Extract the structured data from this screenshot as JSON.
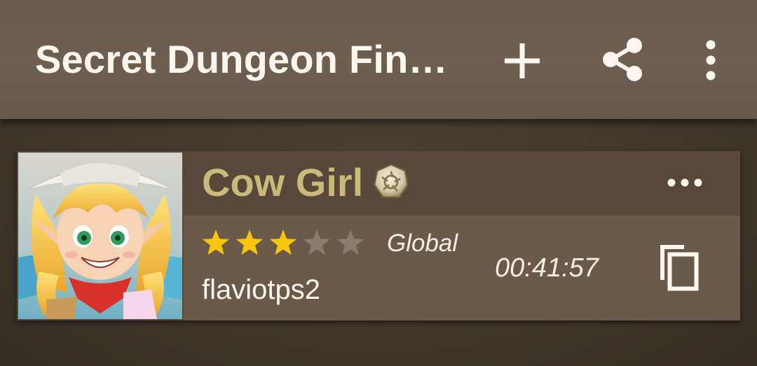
{
  "app_bar": {
    "title": "Secret Dungeon Finder",
    "actions": [
      {
        "icon": "plus-icon",
        "label": "Add"
      },
      {
        "icon": "share-icon",
        "label": "Share"
      },
      {
        "icon": "more-vert-icon",
        "label": "More options"
      }
    ],
    "background_color": "#6d5e4f"
  },
  "dungeon_card": {
    "monster_name": "Cow Girl",
    "element_icon": "wind-element-icon",
    "rating": {
      "filled": 3,
      "max": 5
    },
    "region": "Global",
    "username": "flaviotps2",
    "time_remaining": "00:41:57",
    "menu_icon": "more-horiz-icon",
    "copy_icon": "copy-icon",
    "name_color": "#c9b97a",
    "star_color": "#f6c60d"
  }
}
